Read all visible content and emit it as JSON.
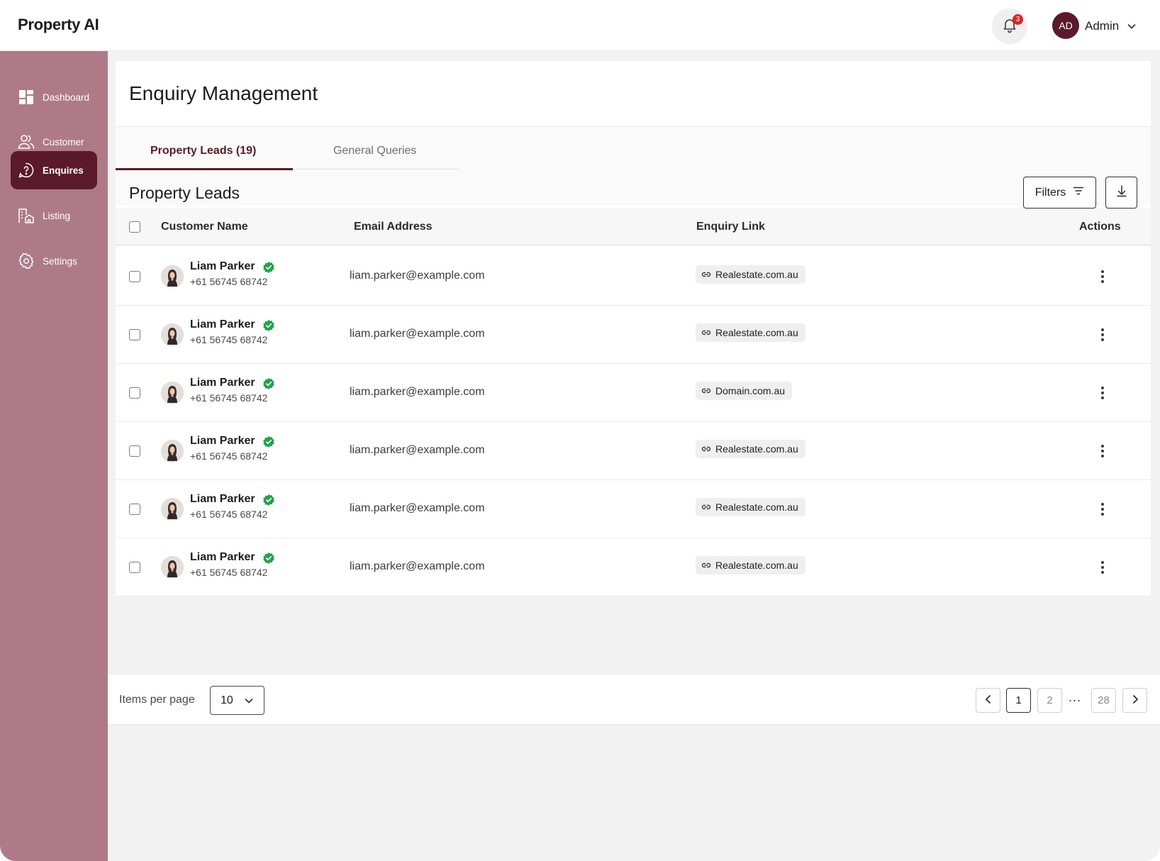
{
  "app": {
    "brand": "Property AI"
  },
  "header": {
    "notification_count": "3",
    "user_initials": "AD",
    "user_name": "Admin"
  },
  "sidebar": {
    "items": [
      {
        "label": "Dashboard",
        "icon": "dashboard-icon",
        "active": false
      },
      {
        "label": "Customer",
        "icon": "users-icon",
        "active": false
      },
      {
        "label": "Enquires",
        "icon": "question-circle-icon",
        "active": true
      },
      {
        "label": "Listing",
        "icon": "building-icon",
        "active": false
      },
      {
        "label": "Settings",
        "icon": "gear-icon",
        "active": false
      }
    ]
  },
  "page": {
    "title": "Enquiry Management",
    "tabs": [
      {
        "label": "Property Leads (19)",
        "active": true
      },
      {
        "label": "General Queries",
        "active": false
      }
    ],
    "section_title": "Property Leads",
    "filters_label": "Filters"
  },
  "table": {
    "columns": [
      "Customer Name",
      "Email Address",
      "Enquiry Link",
      "Actions"
    ],
    "rows": [
      {
        "name": "Liam Parker",
        "phone": "+61 56745 68742",
        "email": "liam.parker@example.com",
        "link": "Realestate.com.au"
      },
      {
        "name": "Liam Parker",
        "phone": "+61 56745 68742",
        "email": "liam.parker@example.com",
        "link": "Realestate.com.au"
      },
      {
        "name": "Liam Parker",
        "phone": "+61 56745 68742",
        "email": "liam.parker@example.com",
        "link": "Domain.com.au"
      },
      {
        "name": "Liam Parker",
        "phone": "+61 56745 68742",
        "email": "liam.parker@example.com",
        "link": "Realestate.com.au"
      },
      {
        "name": "Liam Parker",
        "phone": "+61 56745 68742",
        "email": "liam.parker@example.com",
        "link": "Realestate.com.au"
      },
      {
        "name": "Liam Parker",
        "phone": "+61 56745 68742",
        "email": "liam.parker@example.com",
        "link": "Realestate.com.au"
      }
    ]
  },
  "pagination": {
    "items_per_page_label": "Items per page",
    "items_per_page": "10",
    "pages": [
      "1",
      "2",
      "28"
    ],
    "current_page": "1",
    "ellipsis": "..."
  },
  "colors": {
    "brand": "#5a1a2c",
    "sidebar": "#ae7a88",
    "verified": "#22a447",
    "badge": "#d9262b"
  }
}
